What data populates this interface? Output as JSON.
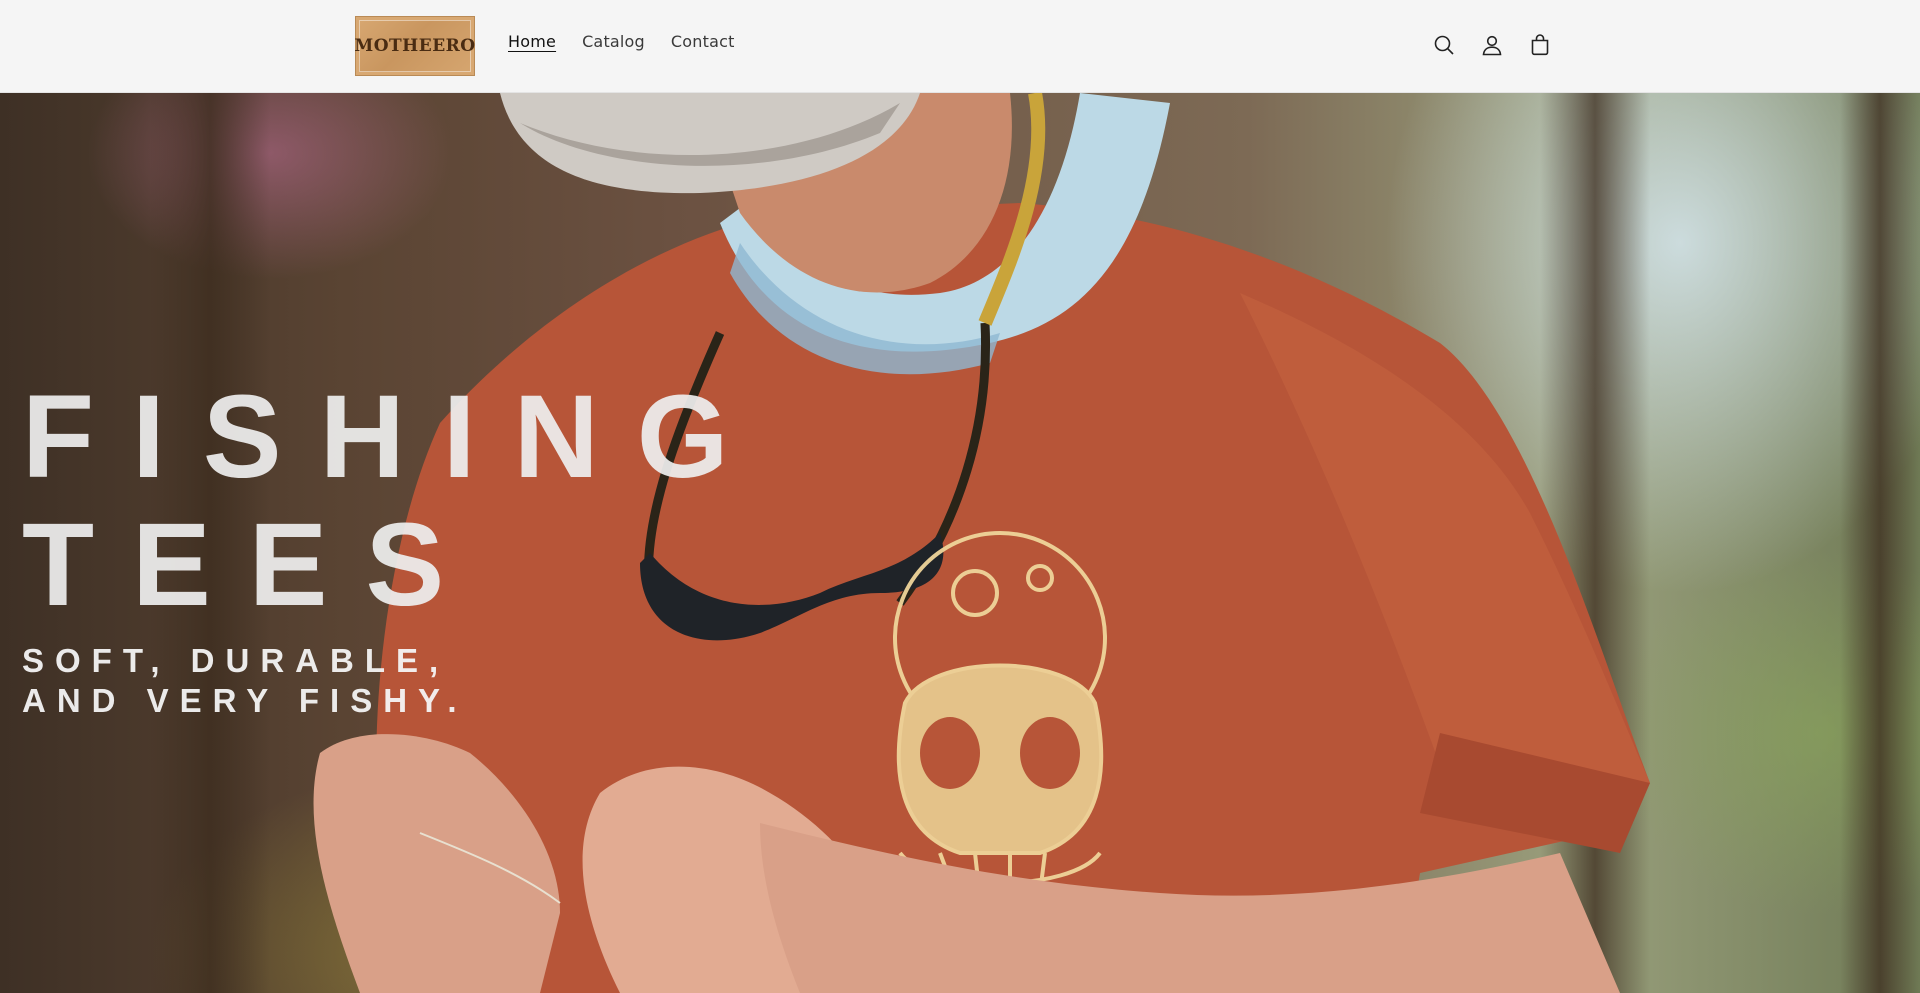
{
  "header": {
    "logo_text": "MOTHEERO",
    "nav": [
      {
        "label": "Home",
        "active": true
      },
      {
        "label": "Catalog",
        "active": false
      },
      {
        "label": "Contact",
        "active": false
      }
    ],
    "icons": [
      "search-icon",
      "account-icon",
      "cart-icon"
    ]
  },
  "hero": {
    "title_lines": [
      "FISHING",
      "TEES"
    ],
    "subtitle_lines": [
      "SOFT, DURABLE,",
      "AND VERY FISHY."
    ]
  },
  "colors": {
    "header_bg": "#f5f5f5",
    "logo_bg": "#d0a06a",
    "logo_text": "#4a2c12",
    "shirt": "#b9553a",
    "hero_text": "#eeeeee"
  }
}
